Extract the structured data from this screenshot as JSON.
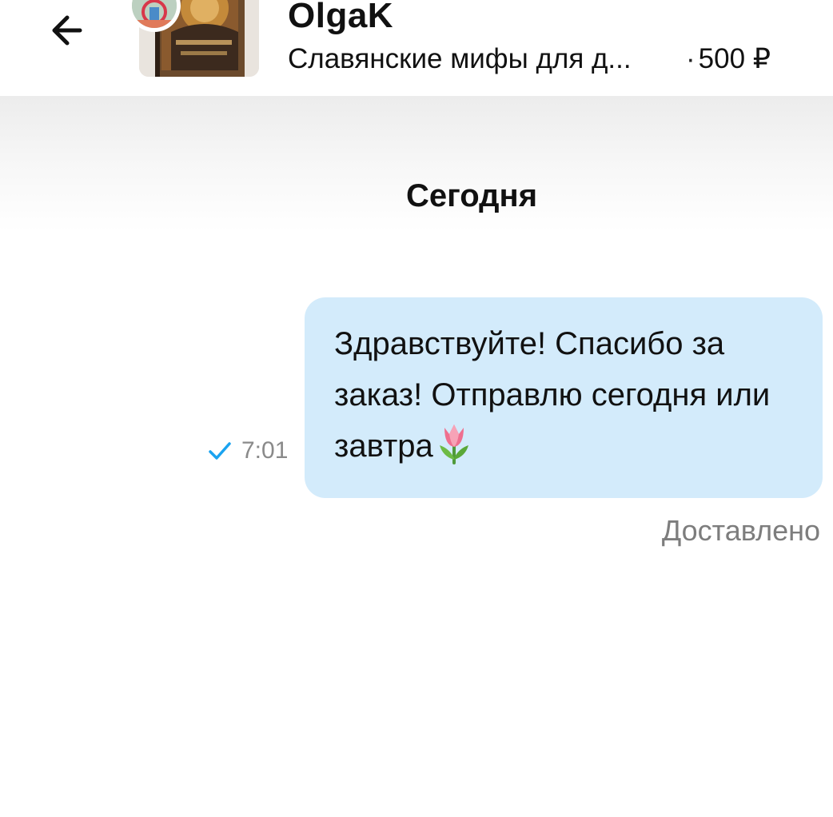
{
  "header": {
    "back_icon": "arrow-left-icon",
    "seller_name": "OlgaK",
    "product_title": "Славянские мифы для д...",
    "price_separator": "·",
    "price": "500 ₽"
  },
  "chat": {
    "date_label": "Сегодня",
    "messages": [
      {
        "direction": "outgoing",
        "text": "Здравствуйте! Спасибо за заказ! Отправлю сегодня или завтра",
        "emoji": "tulip-icon",
        "time": "7:01",
        "status_icon": "check-icon",
        "status_text": "Доставлено"
      }
    ]
  },
  "colors": {
    "bubble_outgoing": "#d3ebfb",
    "check": "#1aa3f0",
    "muted_text": "#7d7d7d"
  }
}
